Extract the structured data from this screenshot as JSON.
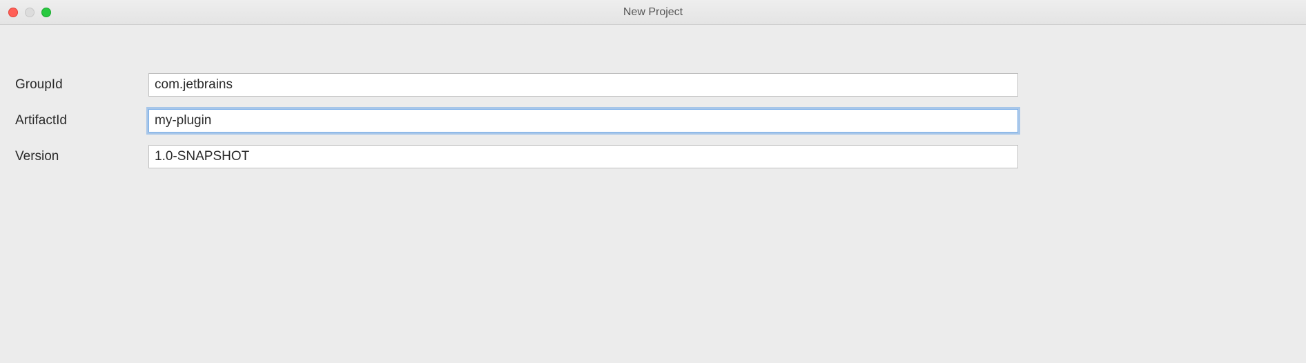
{
  "window": {
    "title": "New Project"
  },
  "form": {
    "groupId": {
      "label": "GroupId",
      "value": "com.jetbrains"
    },
    "artifactId": {
      "label": "ArtifactId",
      "value": "my-plugin"
    },
    "version": {
      "label": "Version",
      "value": "1.0-SNAPSHOT"
    }
  }
}
